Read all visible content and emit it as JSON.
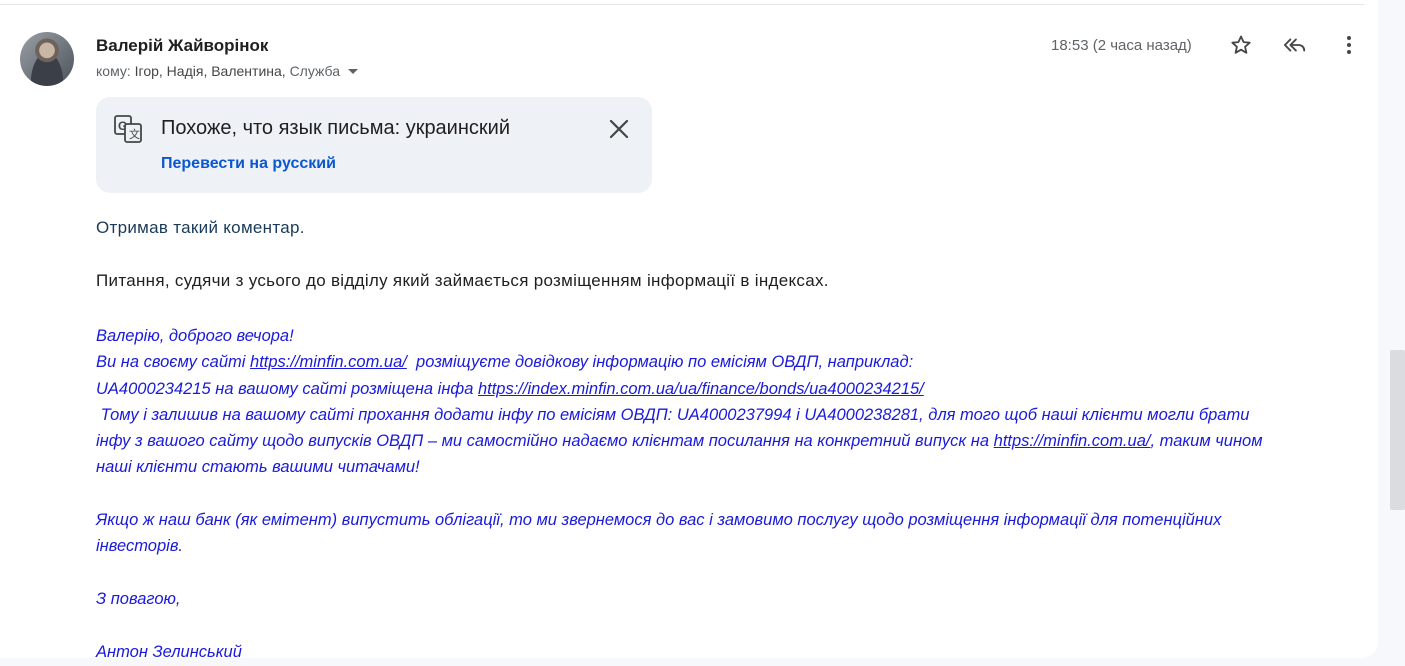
{
  "email": {
    "sender_name": "Валерій Жайворінок",
    "recipients_prefix": "кому:",
    "recipients_main": "Ігор, Надія, Валентина,",
    "recipients_last": "Служба",
    "time": "18:53 (2 часа назад)"
  },
  "icons": {
    "star": "star-icon",
    "reply_all": "reply-all-icon",
    "more": "more-vert-icon",
    "translate": "translate-icon",
    "close": "close-icon"
  },
  "translate_banner": {
    "title": "Похоже, что язык письма: украинский",
    "action": "Перевести на русский"
  },
  "body": {
    "line1": "Отримав такий коментар.",
    "line2": "Питання, судячи з усього до відділу який займається розміщенням інформації в індексах."
  },
  "quote": {
    "greeting": "Валерію, доброго вечора!",
    "p1_a": "Ви на своєму сайті ",
    "p1_link": "https://minfin.com.ua/",
    "p1_b": "  розміщуєте довідкову інформацію по емісіям ОВДП, наприклад:",
    "p2_a": "UA4000234215 на вашому сайті розміщена інфа ",
    "p2_link": "https://index.minfin.com.ua/ua/finance/bonds/ua4000234215/",
    "p3": " Тому і залишив на вашому сайті прохання додати інфу по емісіям ОВДП: UA4000237994 і UA4000238281, для того щоб наші клієнти могли брати",
    "p4_a": "інфу з вашого сайту щодо випусків ОВДП – ми самостійно надаємо клієнтам посилання на конкретний випуск на ",
    "p4_link": "https://minfin.com.ua/",
    "p4_b": ", таким чином",
    "p5": "наші клієнти стають вашими читачами!",
    "p6": "Якщо ж наш банк (як емітент) випустить облігації, то ми звернемося до вас і замовимо послугу щодо розміщення інформації для потенційних",
    "p7": "інвесторів.",
    "regards": "З повагою,",
    "signature": "Антон Зелинський"
  },
  "colors": {
    "link_blue": "#0b57d0",
    "quote_blue": "#1a1adb",
    "banner_bg": "#eef1f6",
    "muted": "#5f6368"
  }
}
